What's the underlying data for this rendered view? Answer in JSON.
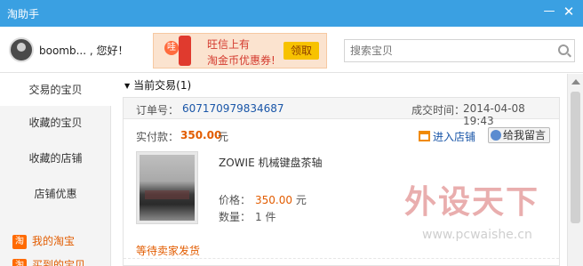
{
  "window": {
    "title": "淘助手",
    "minimize_icon": "minimize-icon",
    "close_icon": "close-icon"
  },
  "header": {
    "greeting": "boomb... , 您好！",
    "banner": {
      "badge": "哇",
      "line1": "旺信上有",
      "line2": "淘金币优惠券!",
      "claim": "领取"
    },
    "search": {
      "placeholder": "搜索宝贝"
    }
  },
  "sidebar": {
    "items": [
      {
        "label": "交易的宝贝"
      },
      {
        "label": "收藏的宝贝"
      },
      {
        "label": "收藏的店铺"
      },
      {
        "label": "店铺优惠"
      }
    ],
    "links": [
      {
        "icon": "淘",
        "label": "我的淘宝"
      },
      {
        "icon": "淘",
        "label": "买到的宝贝"
      }
    ]
  },
  "main": {
    "section": {
      "title": "当前交易(1)"
    },
    "order": {
      "order_label": "订单号：",
      "order_no": "607170979834687",
      "deal_label": "成交时间：",
      "deal_time": "2014-04-08 19:43",
      "pay_label": "实付款：",
      "pay_amount": "350.00",
      "pay_unit": "元",
      "enter_shop": "进入店铺",
      "leave_msg": "给我留言",
      "product_name": "ZOWIE 机械键盘茶轴",
      "price_label": "价格：",
      "price_amount": "350.00",
      "price_unit": "元",
      "qty_label": "数量：",
      "qty_value": "1 件",
      "status": "等待卖家发货"
    }
  },
  "watermark": {
    "text": "外设天下",
    "url": "www.pcwaishe.cn"
  },
  "colors": {
    "titlebar": "#3aa0e2",
    "accent": "#e25c00",
    "link": "#1a56a8"
  }
}
